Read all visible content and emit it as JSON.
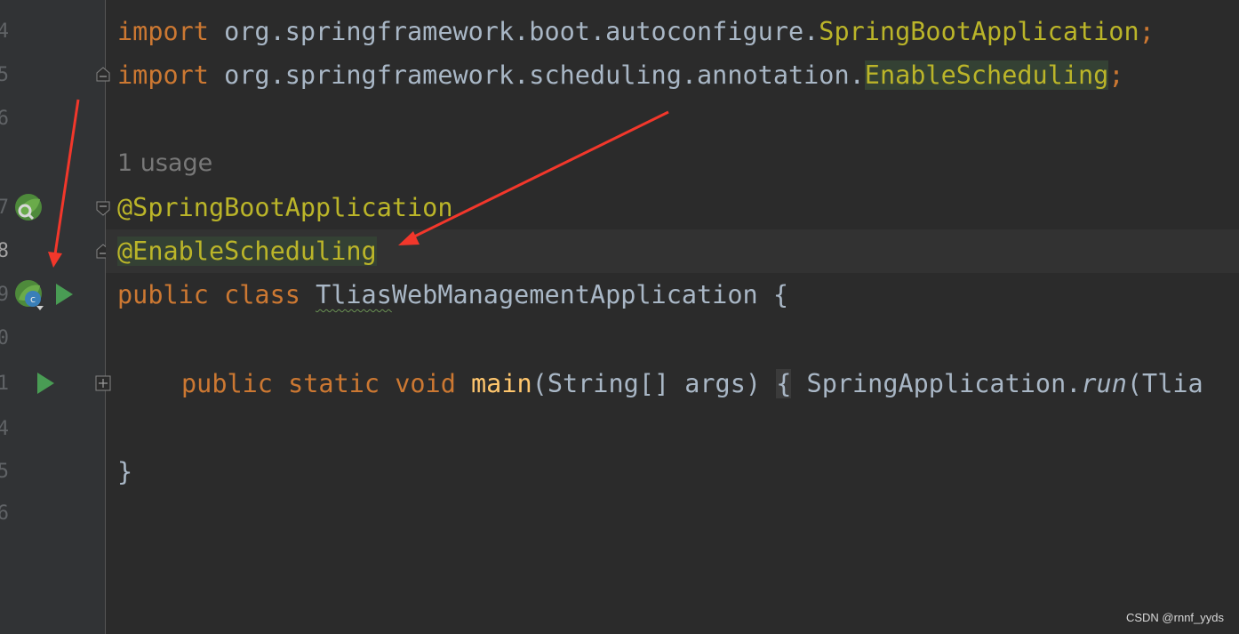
{
  "gutter": {
    "line_numbers": [
      "4",
      "5",
      "6",
      "7",
      "8",
      "9",
      "0",
      "1",
      "4",
      "5",
      "6"
    ],
    "icons": [
      "spring-bean-search-icon",
      "spring-bean-run-icon",
      "run-gutter-icon",
      "run-main-gutter-icon",
      "fold-toggle-icon"
    ]
  },
  "code": {
    "line_import1": {
      "kw": "import",
      "pkg": " org.springframework.boot.autoconfigure.",
      "cls": "SpringBootApplication",
      "end": ";"
    },
    "line_import2": {
      "kw": "import",
      "pkg": " org.springframework.scheduling.annotation.",
      "cls": "EnableScheduling",
      "end": ";"
    },
    "usage_hint": "1 usage",
    "annotation1": "@SpringBootApplication",
    "annotation2": "@EnableScheduling",
    "class_decl": {
      "kw1": "public",
      "kw2": " class ",
      "name_squiggle": "Tlias",
      "name_rest": "WebManagementApplication",
      "brace": " {"
    },
    "main_decl": {
      "kw1": "public",
      "kw2": " static",
      "kw3": " void ",
      "fn": "main",
      "params": "(String[] args) ",
      "folded_open": "{",
      "body_start": " SpringApplication.",
      "call": "run",
      "body_rest": "(Tlia"
    },
    "close_brace": "}"
  },
  "watermark": "CSDN @rnnf_yyds",
  "colors": {
    "background": "#2b2b2b",
    "gutter": "#313335",
    "keyword": "#cc7832",
    "annotation": "#bbb529",
    "function": "#ffc66d",
    "text": "#a9b7c6",
    "arrow": "#ff3b30",
    "run_green": "#499c54"
  }
}
